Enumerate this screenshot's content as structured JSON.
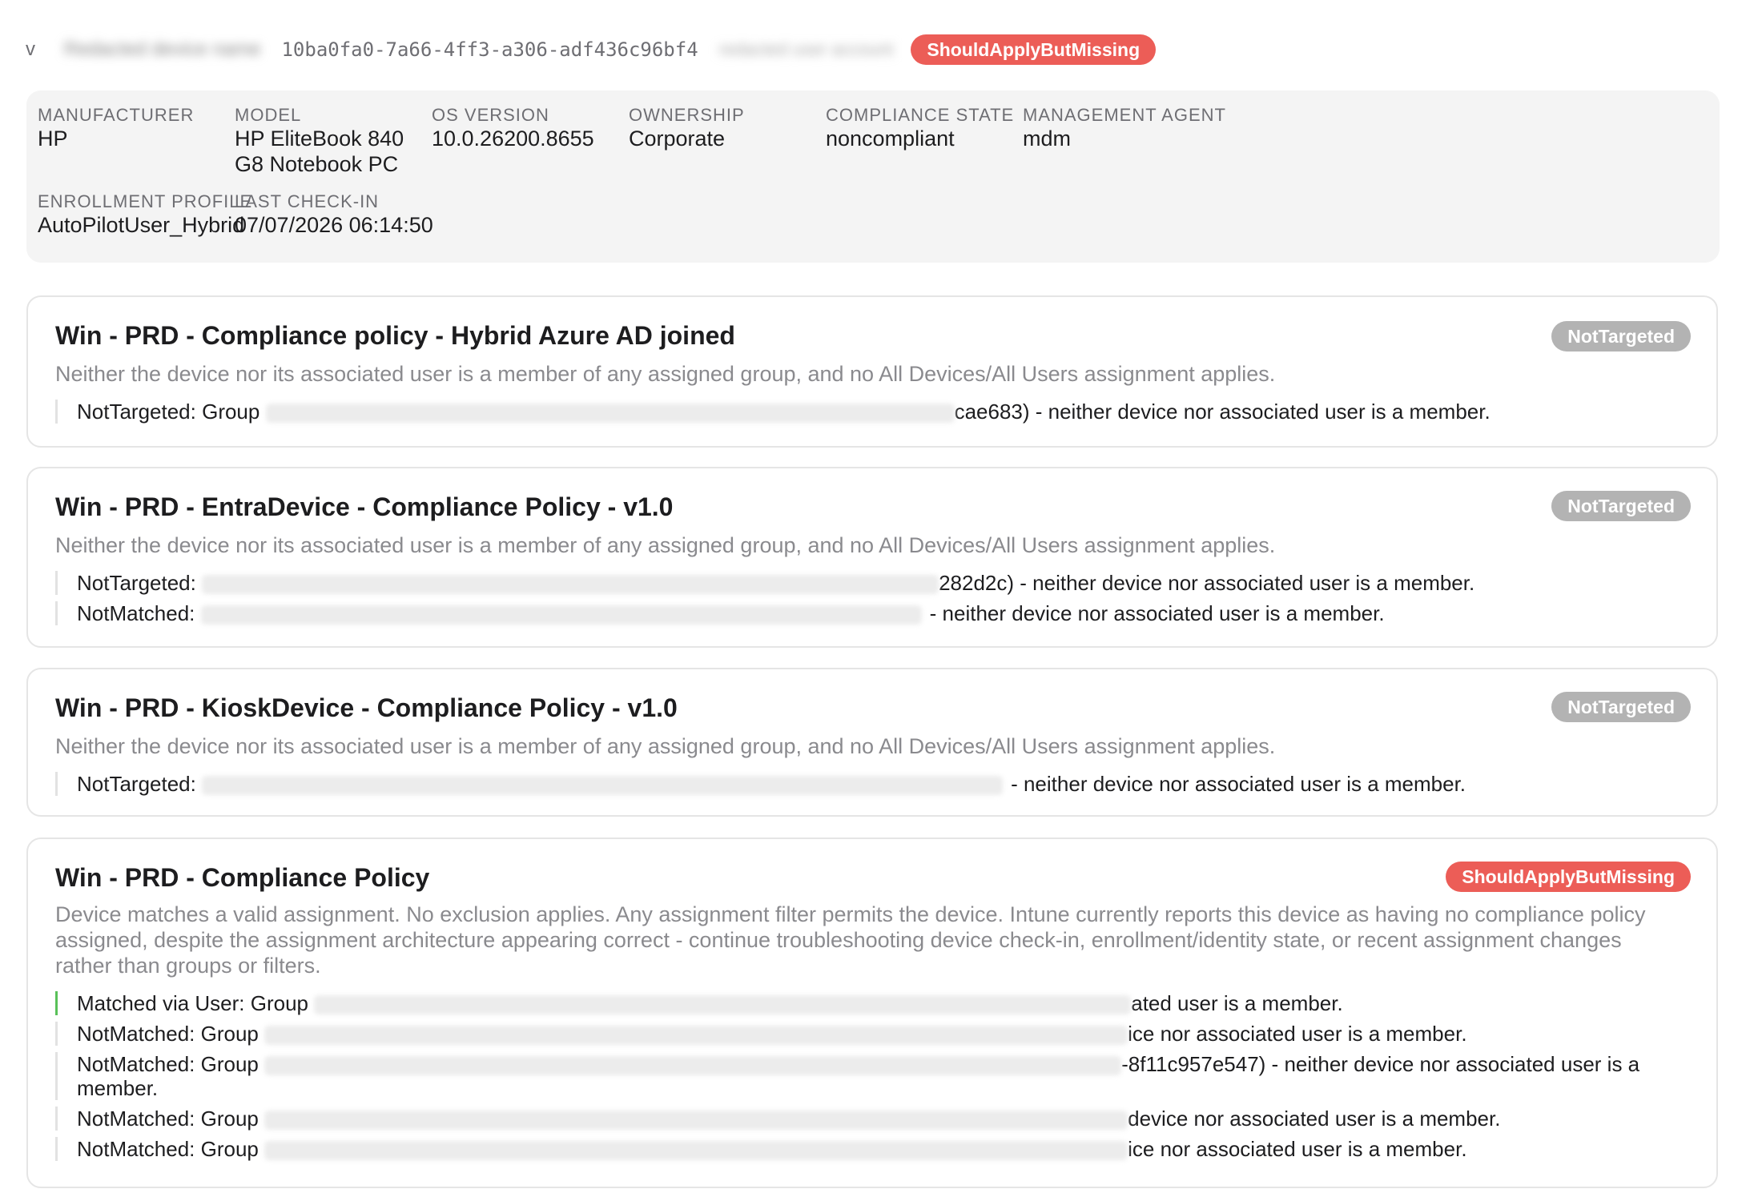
{
  "device": {
    "chevron": "v",
    "name": "Redacted device name",
    "id": "10ba0fa0-7a66-4ff3-a306-adf436c96bf4",
    "user": "redacted user account",
    "status": "ShouldApplyButMissing"
  },
  "properties": {
    "manufacturer": {
      "label": "MANUFACTURER",
      "value": "HP"
    },
    "model": {
      "label": "MODEL",
      "value": "HP EliteBook 840 G8 Notebook PC"
    },
    "os_version": {
      "label": "OS VERSION",
      "value": "10.0.26200.8655"
    },
    "ownership": {
      "label": "OWNERSHIP",
      "value": "Corporate"
    },
    "compliance_state": {
      "label": "COMPLIANCE STATE",
      "value": "noncompliant"
    },
    "management_agent": {
      "label": "MANAGEMENT AGENT",
      "value": "mdm"
    },
    "enrollment_profile": {
      "label": "ENROLLMENT PROFILE",
      "value": "AutoPilotUser_Hybrid"
    },
    "last_checkin": {
      "label": "LAST CHECK-IN",
      "value": "07/07/2026 06:14:50"
    }
  },
  "policies": [
    {
      "title": "Win - PRD - Compliance policy - Hybrid Azure AD joined",
      "status": "NotTargeted",
      "description": "Neither the device nor its associated user is a member of any assigned group, and no All Devices/All Users assignment applies.",
      "reasons": [
        {
          "prefix": "NotTargeted: Group ",
          "suffix": "cae683) - neither device nor associated user is a member."
        }
      ]
    },
    {
      "title": "Win - PRD - EntraDevice - Compliance Policy - v1.0",
      "status": "NotTargeted",
      "description": "Neither the device nor its associated user is a member of any assigned group, and no All Devices/All Users assignment applies.",
      "reasons": [
        {
          "prefix": "NotTargeted: ",
          "suffix": "282d2c) - neither device nor associated user is a member."
        },
        {
          "prefix": "NotMatched: ",
          "suffix": "- neither device nor associated user is a member."
        }
      ]
    },
    {
      "title": "Win - PRD - KioskDevice - Compliance Policy - v1.0",
      "status": "NotTargeted",
      "description": "Neither the device nor its associated user is a member of any assigned group, and no All Devices/All Users assignment applies.",
      "reasons": [
        {
          "prefix": "NotTargeted: ",
          "suffix": "- neither device nor associated user is a member."
        }
      ]
    },
    {
      "title": "Win - PRD - Compliance Policy",
      "status": "ShouldApplyButMissing",
      "description": "Device matches a valid assignment. No exclusion applies. Any assignment filter permits the device. Intune currently reports this device as having no compliance policy assigned, despite the assignment architecture appearing correct - continue troubleshooting device check-in, enrollment/identity state, or recent assignment changes rather than groups or filters.",
      "reasons": [
        {
          "prefix": "Matched via User: Group ",
          "suffix": "ated user is a member."
        },
        {
          "prefix": "NotMatched: Group ",
          "suffix": "ice nor associated user is a member."
        },
        {
          "prefix": "NotMatched: Group ",
          "suffix": "-8f11c957e547) - neither device nor associated user is a",
          "suffix2": "member."
        },
        {
          "prefix": "NotMatched: Group ",
          "suffix": "device nor associated user is a member."
        },
        {
          "prefix": "NotMatched: Group ",
          "suffix": "ice nor associated user is a member."
        }
      ]
    }
  ],
  "colors": {
    "red_badge": "#ec5d57",
    "gray_badge": "#b3b3b3",
    "matched_bar": "#59c159"
  }
}
